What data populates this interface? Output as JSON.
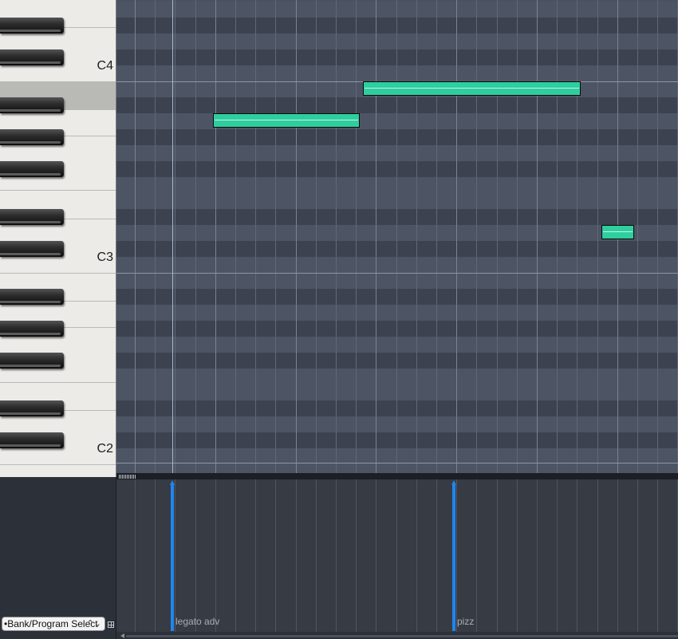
{
  "piano_roll": {
    "octave_labels": [
      "C4",
      "C3",
      "C2"
    ],
    "note_color": "#2fce9f",
    "selected_key_highlight": "#b9b9b5"
  },
  "controller_lane": {
    "selector_label": "•Bank/Program Select",
    "selector_chevron": "⌃⌄",
    "events": [
      {
        "label": "legato adv"
      },
      {
        "label": "pizz"
      }
    ],
    "event_color": "#1f86f0"
  },
  "colors": {
    "grid_dark_row": "#3c4250",
    "grid_light_row": "#4d5565",
    "background": "#2c3038"
  }
}
